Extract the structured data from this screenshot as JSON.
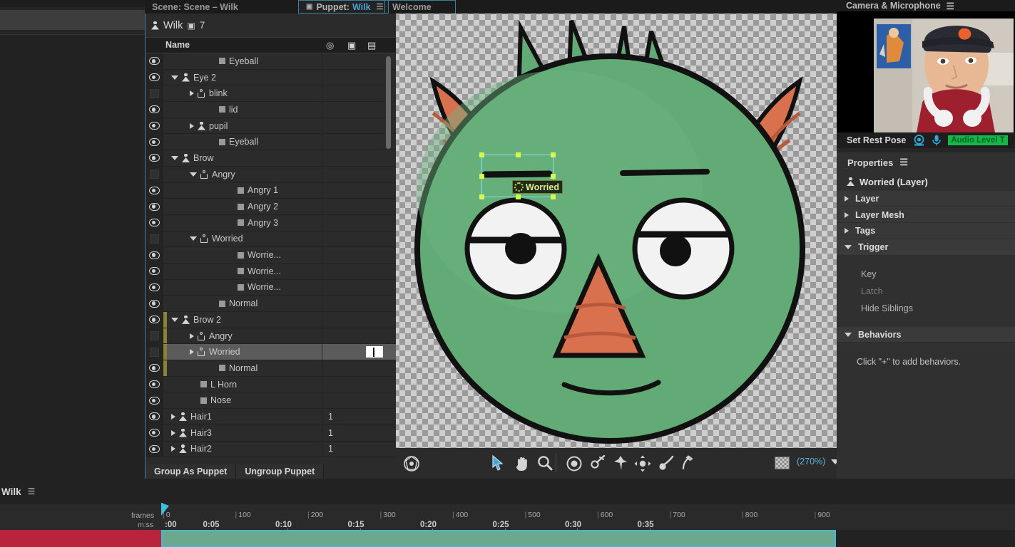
{
  "tabs": [
    {
      "id": "scene",
      "label": "Scene: Scene – Wilk",
      "active": false
    },
    {
      "id": "puppet",
      "label": "Puppet:",
      "accent": "Wilk",
      "active": true
    },
    {
      "id": "welcome",
      "label": "Welcome",
      "active": false
    }
  ],
  "puppet_panel": {
    "title": "Wilk",
    "camera_count": "7",
    "columns": {
      "name": "Name",
      "trigger_icon": "record-icon",
      "camera_icon": "camera-icon",
      "keyboard_icon": "keyboard-icon"
    },
    "footer": {
      "group": "Group As Puppet",
      "ungroup": "Ungroup Puppet"
    },
    "layers": [
      {
        "name": "Eyeball",
        "indent": 4,
        "visible": true,
        "expander": "none",
        "icon": "square",
        "trigger": "",
        "selected": false,
        "group_mark": false
      },
      {
        "name": "Eye 2",
        "indent": 2,
        "visible": true,
        "expander": "down",
        "icon": "puppet-solid",
        "trigger": "",
        "selected": false,
        "group_mark": false
      },
      {
        "name": "blink",
        "indent": 3,
        "visible": false,
        "expander": "right",
        "icon": "puppet-hollow",
        "trigger": "",
        "selected": false,
        "group_mark": false
      },
      {
        "name": "lid",
        "indent": 4,
        "visible": true,
        "expander": "none",
        "icon": "square",
        "trigger": "",
        "selected": false,
        "group_mark": false
      },
      {
        "name": "pupil",
        "indent": 3,
        "visible": true,
        "expander": "right",
        "icon": "puppet-solid",
        "trigger": "",
        "selected": false,
        "group_mark": false
      },
      {
        "name": "Eyeball",
        "indent": 4,
        "visible": true,
        "expander": "none",
        "icon": "square",
        "trigger": "",
        "selected": false,
        "group_mark": false
      },
      {
        "name": "Brow",
        "indent": 2,
        "visible": true,
        "expander": "down",
        "icon": "puppet-solid",
        "trigger": "",
        "selected": false,
        "group_mark": false
      },
      {
        "name": "Angry",
        "indent": 3,
        "visible": false,
        "expander": "down",
        "icon": "puppet-hollow",
        "trigger": "",
        "selected": false,
        "group_mark": false
      },
      {
        "name": "Angry 1",
        "indent": 5,
        "visible": true,
        "expander": "none",
        "icon": "square",
        "trigger": "",
        "selected": false,
        "group_mark": false
      },
      {
        "name": "Angry 2",
        "indent": 5,
        "visible": true,
        "expander": "none",
        "icon": "square",
        "trigger": "",
        "selected": false,
        "group_mark": false
      },
      {
        "name": "Angry 3",
        "indent": 5,
        "visible": true,
        "expander": "none",
        "icon": "square",
        "trigger": "",
        "selected": false,
        "group_mark": false
      },
      {
        "name": "Worried",
        "indent": 3,
        "visible": false,
        "expander": "down",
        "icon": "puppet-hollow",
        "trigger": "",
        "selected": false,
        "group_mark": false
      },
      {
        "name": "Worrie...",
        "indent": 5,
        "visible": true,
        "expander": "none",
        "icon": "square",
        "trigger": "",
        "selected": false,
        "group_mark": false
      },
      {
        "name": "Worrie...",
        "indent": 5,
        "visible": true,
        "expander": "none",
        "icon": "square",
        "trigger": "",
        "selected": false,
        "group_mark": false
      },
      {
        "name": "Worrie...",
        "indent": 5,
        "visible": true,
        "expander": "none",
        "icon": "square",
        "trigger": "",
        "selected": false,
        "group_mark": false
      },
      {
        "name": "Normal",
        "indent": 4,
        "visible": true,
        "expander": "none",
        "icon": "square",
        "trigger": "",
        "selected": false,
        "group_mark": false
      },
      {
        "name": "Brow 2",
        "indent": 2,
        "visible": true,
        "expander": "down",
        "icon": "puppet-solid",
        "trigger": "",
        "selected": false,
        "group_mark": true
      },
      {
        "name": "Angry",
        "indent": 3,
        "visible": false,
        "expander": "right",
        "icon": "puppet-hollow",
        "trigger": "",
        "selected": false,
        "group_mark": true
      },
      {
        "name": "Worried",
        "indent": 3,
        "visible": false,
        "expander": "right",
        "icon": "puppet-hollow",
        "trigger": "",
        "selected": true,
        "editing": true,
        "group_mark": true
      },
      {
        "name": "Normal",
        "indent": 4,
        "visible": true,
        "expander": "none",
        "icon": "square",
        "trigger": "",
        "selected": false,
        "group_mark": true
      },
      {
        "name": "L Horn",
        "indent": 3,
        "visible": true,
        "expander": "none",
        "icon": "square",
        "trigger": "",
        "selected": false,
        "group_mark": false
      },
      {
        "name": "Nose",
        "indent": 3,
        "visible": true,
        "expander": "none",
        "icon": "square",
        "trigger": "",
        "selected": false,
        "group_mark": false
      },
      {
        "name": "Hair1",
        "indent": 2,
        "visible": true,
        "expander": "right",
        "icon": "puppet-solid",
        "trigger": "1",
        "selected": false,
        "group_mark": false
      },
      {
        "name": "Hair3",
        "indent": 2,
        "visible": true,
        "expander": "right",
        "icon": "puppet-solid",
        "trigger": "1",
        "selected": false,
        "group_mark": false
      },
      {
        "name": "Hair2",
        "indent": 2,
        "visible": true,
        "expander": "right",
        "icon": "puppet-solid",
        "trigger": "1",
        "selected": false,
        "group_mark": false
      }
    ]
  },
  "canvas": {
    "selection_label": "Worried",
    "zoom": "(270%)",
    "tools": [
      {
        "name": "puppet-pin-origin-icon"
      },
      {
        "name": "select-arrow-icon"
      },
      {
        "name": "hand-icon"
      },
      {
        "name": "zoom-magnifier-icon"
      },
      {
        "name": "origin-target-icon"
      },
      {
        "name": "dangle-pin-icon"
      },
      {
        "name": "stick-pin-icon"
      },
      {
        "name": "transform-handle-icon"
      },
      {
        "name": "dragger-icon"
      },
      {
        "name": "pen-stick-icon"
      }
    ],
    "character_colors": {
      "body": "#63ab76",
      "horn": "#d9714f",
      "outline": "#111111",
      "eye_white": "#f2f2f2",
      "pupil": "#111111"
    }
  },
  "camera_panel": {
    "title": "Camera & Microphone",
    "set_rest_pose": "Set Rest Pose",
    "audio_level": "Audio Level T"
  },
  "properties": {
    "title": "Properties",
    "object": "Worried (Layer)",
    "sections": [
      {
        "label": "Layer",
        "open": false
      },
      {
        "label": "Layer Mesh",
        "open": false
      },
      {
        "label": "Tags",
        "open": false
      },
      {
        "label": "Trigger",
        "open": true
      }
    ],
    "trigger_items": [
      {
        "label": "Key",
        "dim": false
      },
      {
        "label": "Latch",
        "dim": true
      },
      {
        "label": "Hide Siblings",
        "dim": false
      }
    ],
    "behaviors": {
      "label": "Behaviors",
      "note": "Click \"+\" to add behaviors."
    }
  },
  "timeline": {
    "name": "Wilk",
    "frames_label": "frames",
    "mss_label": "m:ss",
    "frame_ticks": [
      "0",
      "100",
      "200",
      "300",
      "400",
      "500",
      "600",
      "700",
      "800",
      "900"
    ],
    "time_ticks": [
      ":00",
      "0:05",
      "0:10",
      "0:15",
      "0:20",
      "0:25",
      "0:30",
      "0:35"
    ],
    "colors": {
      "track_a": "#b9243c",
      "track_b": "#6aa98e",
      "playhead": "#3ec0dc"
    }
  }
}
